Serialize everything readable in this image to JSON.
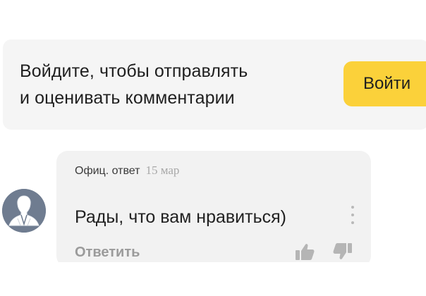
{
  "login_banner": {
    "line1": "Войдите, чтобы отправлять",
    "line2": "и оценивать комментарии",
    "button_label": "Войти",
    "button_color": "#fbd13a"
  },
  "comment": {
    "author": "Офиц. ответ",
    "date": "15 мар",
    "text": "Рады, что вам нравиться)",
    "reply_label": "Ответить",
    "icons": {
      "avatar": "user-silhouette-icon",
      "menu": "more-vertical-icon",
      "like": "thumbs-up-icon",
      "dislike": "thumbs-down-icon"
    }
  }
}
